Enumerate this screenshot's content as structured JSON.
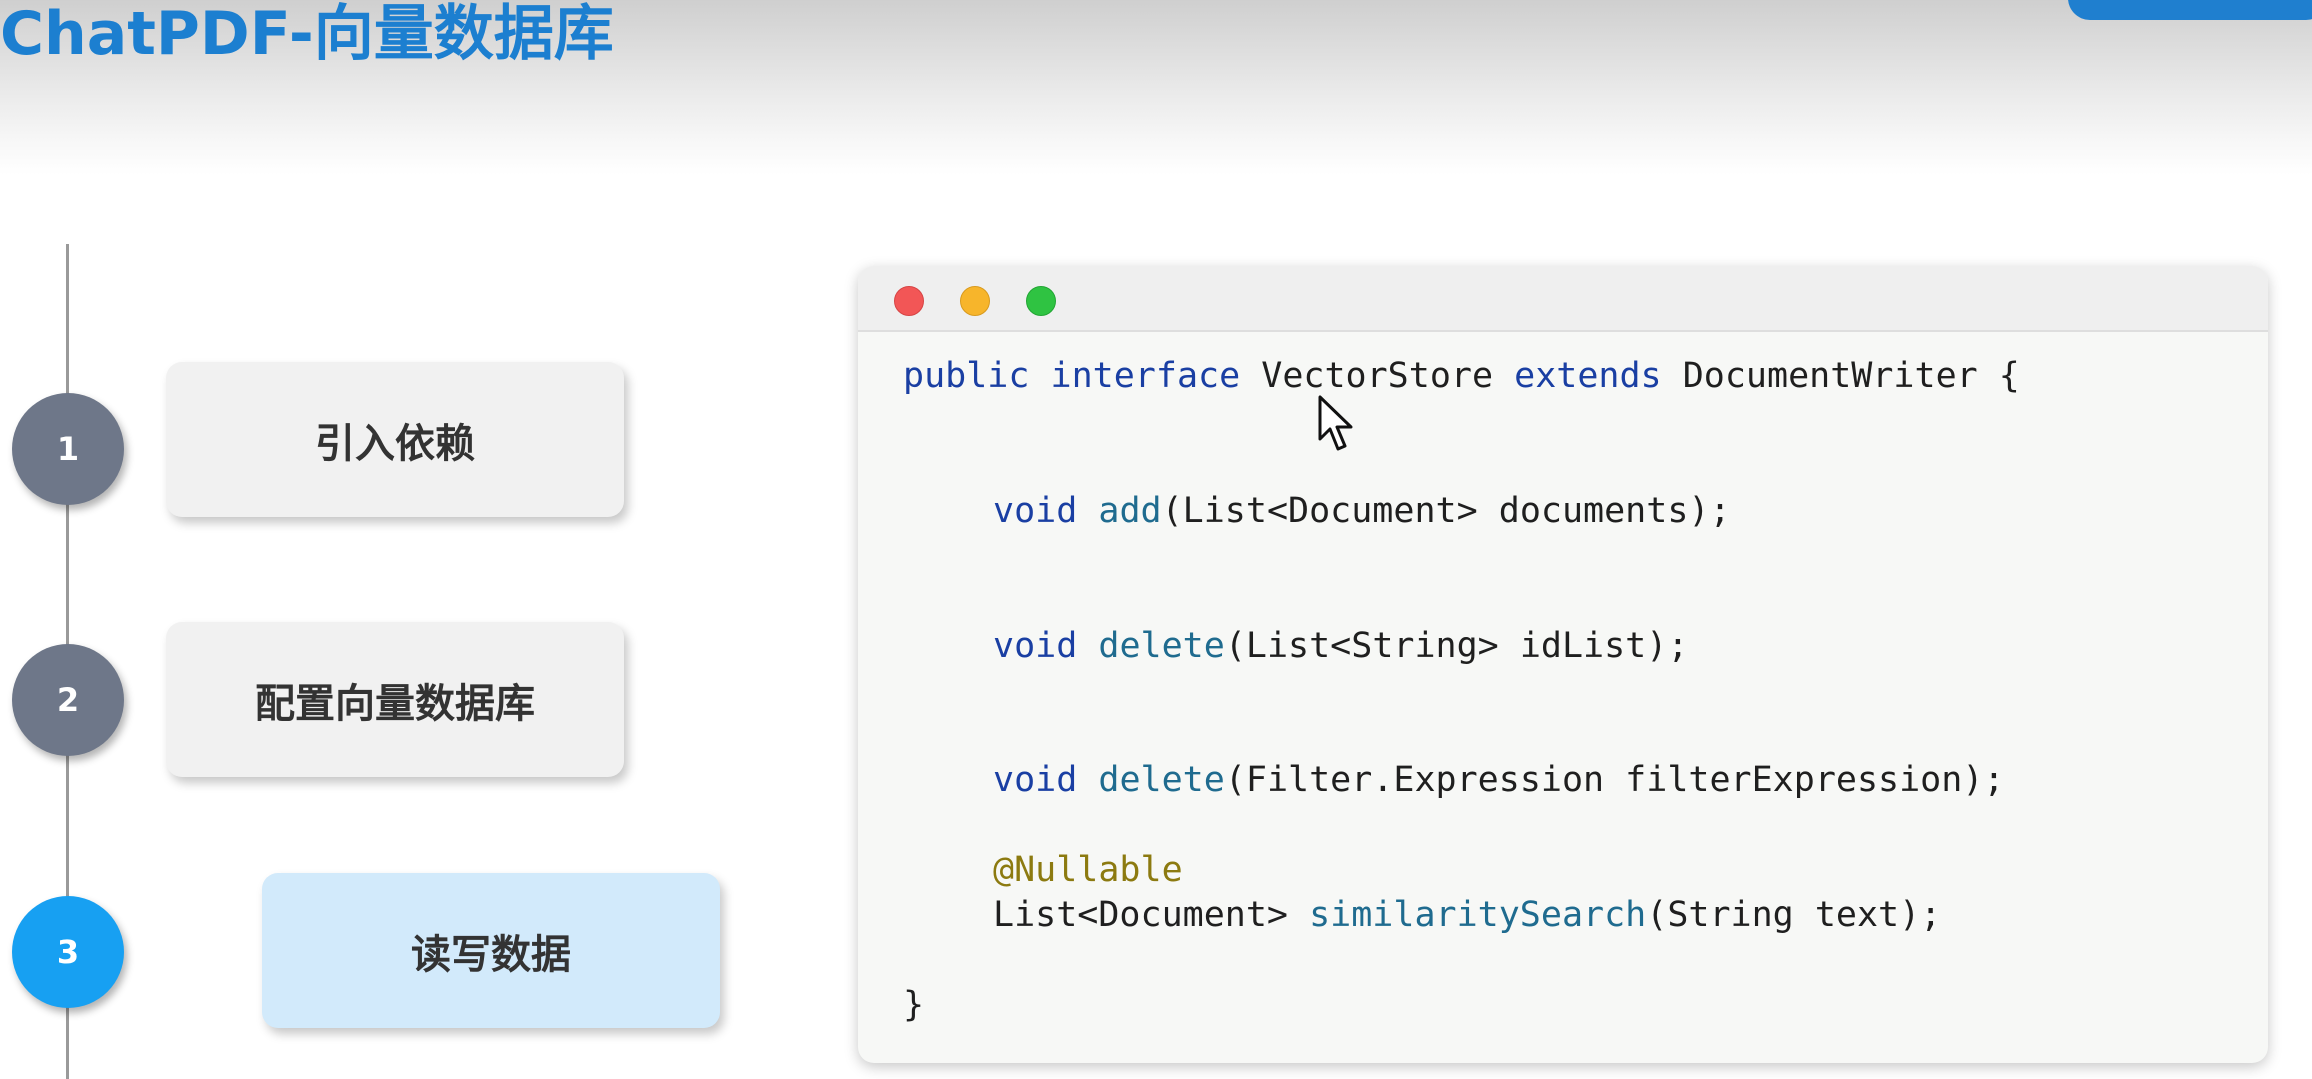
{
  "header": {
    "title": "ChatPDF-向量数据库"
  },
  "steps": [
    {
      "number": "1",
      "label": "引入依赖",
      "state": "default"
    },
    {
      "number": "2",
      "label": "配置向量数据库",
      "state": "default"
    },
    {
      "number": "3",
      "label": "读写数据",
      "state": "active"
    }
  ],
  "code_window": {
    "line1": {
      "kw1": "public",
      "kw2": "interface",
      "name": "VectorStore",
      "kw3": "extends",
      "parent": "DocumentWriter {"
    },
    "line2": {
      "kw": "void",
      "fn": "add",
      "rest": "(List<Document> documents);"
    },
    "line3": {
      "kw": "void",
      "fn": "delete",
      "rest": "(List<String> idList);"
    },
    "line4": {
      "kw": "void",
      "fn": "delete",
      "rest": "(Filter.Expression filterExpression);"
    },
    "line5": {
      "annotation": "@Nullable"
    },
    "line6": {
      "type": "List<Document>",
      "fn": "similaritySearch",
      "rest": "(String text);"
    },
    "line7": {
      "text": "}"
    }
  },
  "colors": {
    "title": "#1c7fd0",
    "active_step": "#17a0f2",
    "inactive_step": "#6e7789",
    "active_card": "#d2eafb",
    "keyword": "#1a3fa3",
    "annotation": "#8c7a10"
  },
  "icons": [
    "window-close-dot",
    "window-minimize-dot",
    "window-maximize-dot",
    "mouse-pointer-icon"
  ]
}
